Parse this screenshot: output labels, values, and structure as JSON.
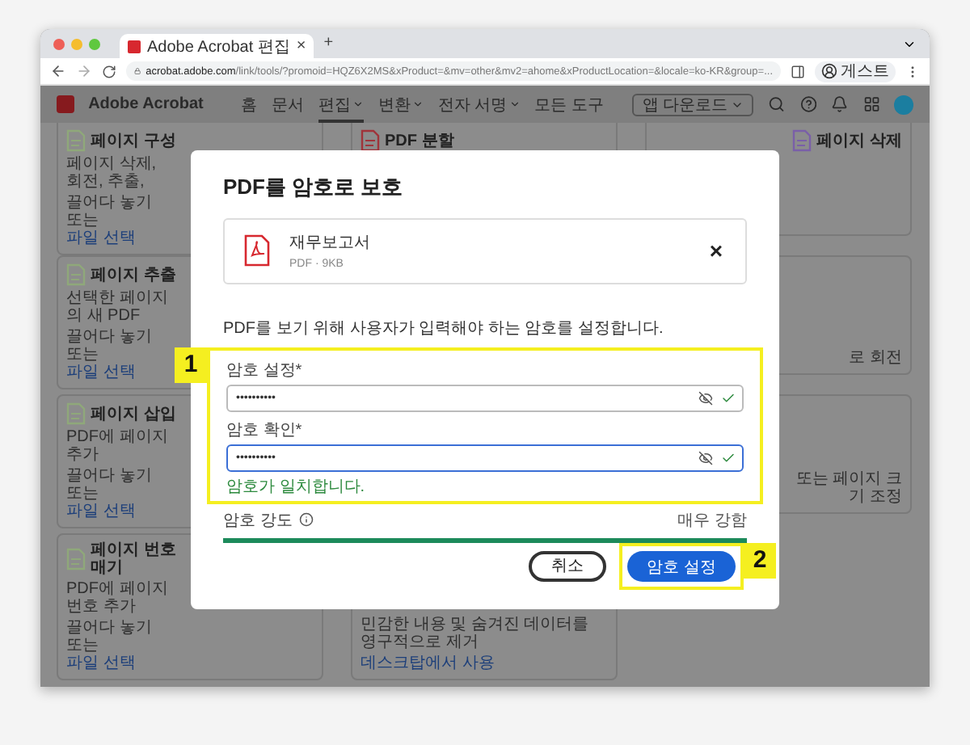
{
  "browser": {
    "tab": {
      "title": "Adobe Acrobat 편집",
      "close": "×"
    },
    "new_tab": "+",
    "url": {
      "host": "acrobat.adobe.com",
      "path": "/link/tools/?promoid=HQZ6X2MS&xProduct=&mv=other&mv2=ahome&xProductLocation=&locale=ko-KR&group=..."
    },
    "profile": "게스트"
  },
  "app": {
    "brand": "Adobe Acrobat",
    "nav": [
      {
        "label": "홈",
        "dropdown": false,
        "selected": false
      },
      {
        "label": "문서",
        "dropdown": false,
        "selected": false
      },
      {
        "label": "편집",
        "dropdown": true,
        "selected": true
      },
      {
        "label": "변환",
        "dropdown": true,
        "selected": false
      },
      {
        "label": "전자 서명",
        "dropdown": true,
        "selected": false
      },
      {
        "label": "모든 도구",
        "dropdown": false,
        "selected": false
      }
    ],
    "download_button": "앱 다운로드"
  },
  "columns": [
    [
      {
        "title": "페이지 구성",
        "description": "페이지 삭제, 회전, 추출,",
        "link_prefix": "끌어다 놓기 또는",
        "link": "파일 선택"
      },
      {
        "title": "페이지 추출",
        "description": "선택한 페이지의 새 PDF",
        "link_prefix": "끌어다 놓기 또는",
        "link": "파일 선택"
      },
      {
        "title": "페이지 삽입",
        "description": "PDF에 페이지 추가",
        "link_prefix": "끌어다 놓기 또는",
        "link": "파일 선택"
      },
      {
        "title": "페이지 번호 매기",
        "description": "PDF에 페이지 번호 추가",
        "link_prefix": "끌어다 놓기 또는",
        "link": "파일 선택"
      }
    ],
    [
      {
        "title": "PDF 분할"
      },
      {},
      {},
      {
        "description": "민감한 내용 및 숨겨진 데이터를 영구적으로 제거",
        "link": "데스크탑에서 사용"
      }
    ],
    [
      {
        "title": "페이지 삭제"
      },
      {
        "description": "로 회전"
      },
      {
        "description": "또는 페이지 크기 조정"
      }
    ]
  ],
  "dialog": {
    "title": "PDF를 암호로 보호",
    "file": {
      "name": "재무보고서",
      "meta": "PDF · 9KB",
      "remove": "×"
    },
    "instruction": "PDF를 보기 위해 사용자가 입력해야 하는 암호를 설정합니다.",
    "fields": [
      {
        "label": "암호 설정*",
        "value": "••••••••••",
        "focused": false,
        "valid": true
      },
      {
        "label": "암호 확인*",
        "value": "••••••••••",
        "focused": true,
        "valid": true
      }
    ],
    "match_message": "암호가 일치합니다.",
    "strength": {
      "label": "암호 강도",
      "rating": "매우 강함",
      "level": 1
    },
    "buttons": [
      {
        "label": "취소",
        "kind": "secondary"
      },
      {
        "label": "암호 설정",
        "kind": "primary"
      }
    ]
  },
  "callouts": [
    {
      "label": "1"
    },
    {
      "label": "2"
    }
  ]
}
